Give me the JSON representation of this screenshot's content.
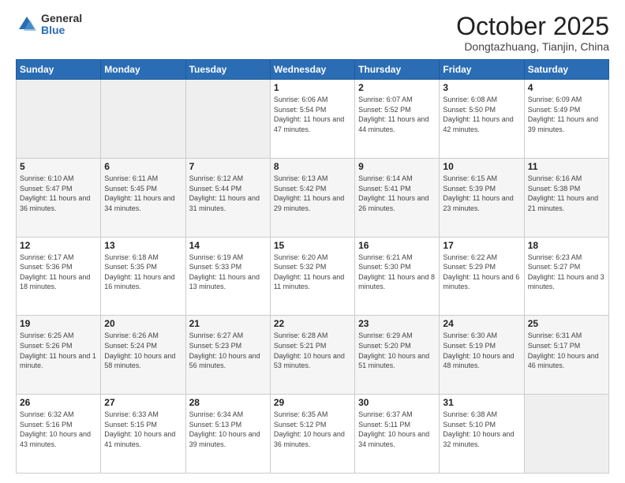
{
  "header": {
    "logo_general": "General",
    "logo_blue": "Blue",
    "title": "October 2025",
    "location": "Dongtazhuang, Tianjin, China"
  },
  "weekdays": [
    "Sunday",
    "Monday",
    "Tuesday",
    "Wednesday",
    "Thursday",
    "Friday",
    "Saturday"
  ],
  "weeks": [
    [
      {
        "day": "",
        "info": ""
      },
      {
        "day": "",
        "info": ""
      },
      {
        "day": "",
        "info": ""
      },
      {
        "day": "1",
        "info": "Sunrise: 6:06 AM\nSunset: 5:54 PM\nDaylight: 11 hours and 47 minutes."
      },
      {
        "day": "2",
        "info": "Sunrise: 6:07 AM\nSunset: 5:52 PM\nDaylight: 11 hours and 44 minutes."
      },
      {
        "day": "3",
        "info": "Sunrise: 6:08 AM\nSunset: 5:50 PM\nDaylight: 11 hours and 42 minutes."
      },
      {
        "day": "4",
        "info": "Sunrise: 6:09 AM\nSunset: 5:49 PM\nDaylight: 11 hours and 39 minutes."
      }
    ],
    [
      {
        "day": "5",
        "info": "Sunrise: 6:10 AM\nSunset: 5:47 PM\nDaylight: 11 hours and 36 minutes."
      },
      {
        "day": "6",
        "info": "Sunrise: 6:11 AM\nSunset: 5:45 PM\nDaylight: 11 hours and 34 minutes."
      },
      {
        "day": "7",
        "info": "Sunrise: 6:12 AM\nSunset: 5:44 PM\nDaylight: 11 hours and 31 minutes."
      },
      {
        "day": "8",
        "info": "Sunrise: 6:13 AM\nSunset: 5:42 PM\nDaylight: 11 hours and 29 minutes."
      },
      {
        "day": "9",
        "info": "Sunrise: 6:14 AM\nSunset: 5:41 PM\nDaylight: 11 hours and 26 minutes."
      },
      {
        "day": "10",
        "info": "Sunrise: 6:15 AM\nSunset: 5:39 PM\nDaylight: 11 hours and 23 minutes."
      },
      {
        "day": "11",
        "info": "Sunrise: 6:16 AM\nSunset: 5:38 PM\nDaylight: 11 hours and 21 minutes."
      }
    ],
    [
      {
        "day": "12",
        "info": "Sunrise: 6:17 AM\nSunset: 5:36 PM\nDaylight: 11 hours and 18 minutes."
      },
      {
        "day": "13",
        "info": "Sunrise: 6:18 AM\nSunset: 5:35 PM\nDaylight: 11 hours and 16 minutes."
      },
      {
        "day": "14",
        "info": "Sunrise: 6:19 AM\nSunset: 5:33 PM\nDaylight: 11 hours and 13 minutes."
      },
      {
        "day": "15",
        "info": "Sunrise: 6:20 AM\nSunset: 5:32 PM\nDaylight: 11 hours and 11 minutes."
      },
      {
        "day": "16",
        "info": "Sunrise: 6:21 AM\nSunset: 5:30 PM\nDaylight: 11 hours and 8 minutes."
      },
      {
        "day": "17",
        "info": "Sunrise: 6:22 AM\nSunset: 5:29 PM\nDaylight: 11 hours and 6 minutes."
      },
      {
        "day": "18",
        "info": "Sunrise: 6:23 AM\nSunset: 5:27 PM\nDaylight: 11 hours and 3 minutes."
      }
    ],
    [
      {
        "day": "19",
        "info": "Sunrise: 6:25 AM\nSunset: 5:26 PM\nDaylight: 11 hours and 1 minute."
      },
      {
        "day": "20",
        "info": "Sunrise: 6:26 AM\nSunset: 5:24 PM\nDaylight: 10 hours and 58 minutes."
      },
      {
        "day": "21",
        "info": "Sunrise: 6:27 AM\nSunset: 5:23 PM\nDaylight: 10 hours and 56 minutes."
      },
      {
        "day": "22",
        "info": "Sunrise: 6:28 AM\nSunset: 5:21 PM\nDaylight: 10 hours and 53 minutes."
      },
      {
        "day": "23",
        "info": "Sunrise: 6:29 AM\nSunset: 5:20 PM\nDaylight: 10 hours and 51 minutes."
      },
      {
        "day": "24",
        "info": "Sunrise: 6:30 AM\nSunset: 5:19 PM\nDaylight: 10 hours and 48 minutes."
      },
      {
        "day": "25",
        "info": "Sunrise: 6:31 AM\nSunset: 5:17 PM\nDaylight: 10 hours and 46 minutes."
      }
    ],
    [
      {
        "day": "26",
        "info": "Sunrise: 6:32 AM\nSunset: 5:16 PM\nDaylight: 10 hours and 43 minutes."
      },
      {
        "day": "27",
        "info": "Sunrise: 6:33 AM\nSunset: 5:15 PM\nDaylight: 10 hours and 41 minutes."
      },
      {
        "day": "28",
        "info": "Sunrise: 6:34 AM\nSunset: 5:13 PM\nDaylight: 10 hours and 39 minutes."
      },
      {
        "day": "29",
        "info": "Sunrise: 6:35 AM\nSunset: 5:12 PM\nDaylight: 10 hours and 36 minutes."
      },
      {
        "day": "30",
        "info": "Sunrise: 6:37 AM\nSunset: 5:11 PM\nDaylight: 10 hours and 34 minutes."
      },
      {
        "day": "31",
        "info": "Sunrise: 6:38 AM\nSunset: 5:10 PM\nDaylight: 10 hours and 32 minutes."
      },
      {
        "day": "",
        "info": ""
      }
    ]
  ]
}
